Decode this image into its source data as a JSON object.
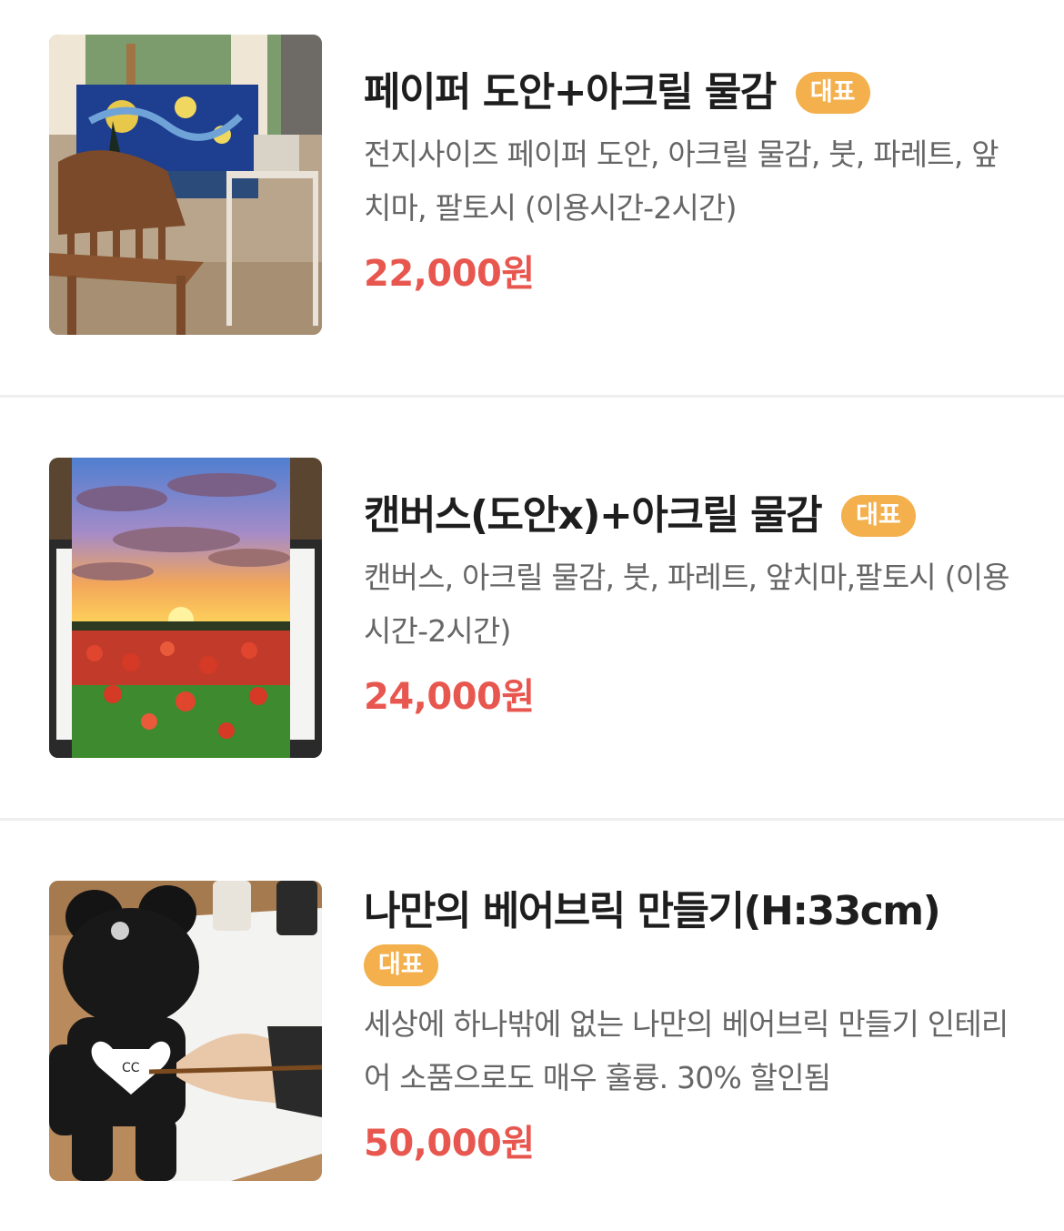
{
  "menu_items": [
    {
      "title": "페이퍼 도안+아크릴 물감",
      "badge": "대표",
      "description": "전지사이즈 페이퍼 도안, 아크릴 물감, 붓, 파레트, 앞치마, 팔토시 (이용시간-2시간)",
      "price": "22,000원",
      "image_icon": "easel-starry-night-photo"
    },
    {
      "title": "캔버스(도안x)+아크릴 물감",
      "badge": "대표",
      "description": "캔버스, 아크릴 물감, 붓, 파레트, 앞치마,팔토시 (이용시간-2시간)",
      "price": "24,000원",
      "image_icon": "sunset-poppy-canvas-photo"
    },
    {
      "title": "나만의 베어브릭 만들기(H:33cm)",
      "badge": "대표",
      "description": "세상에 하나밖에 없는 나만의 베어브릭 만들기 인테리어 소품으로도 매우 훌륭. 30% 할인됨",
      "price": "50,000원",
      "image_icon": "bearbrick-painting-photo"
    }
  ],
  "colors": {
    "badge": "#f3b04c",
    "price": "#e8574f",
    "title": "#1e1e1e",
    "description": "#666666",
    "divider": "#eeeeee"
  }
}
